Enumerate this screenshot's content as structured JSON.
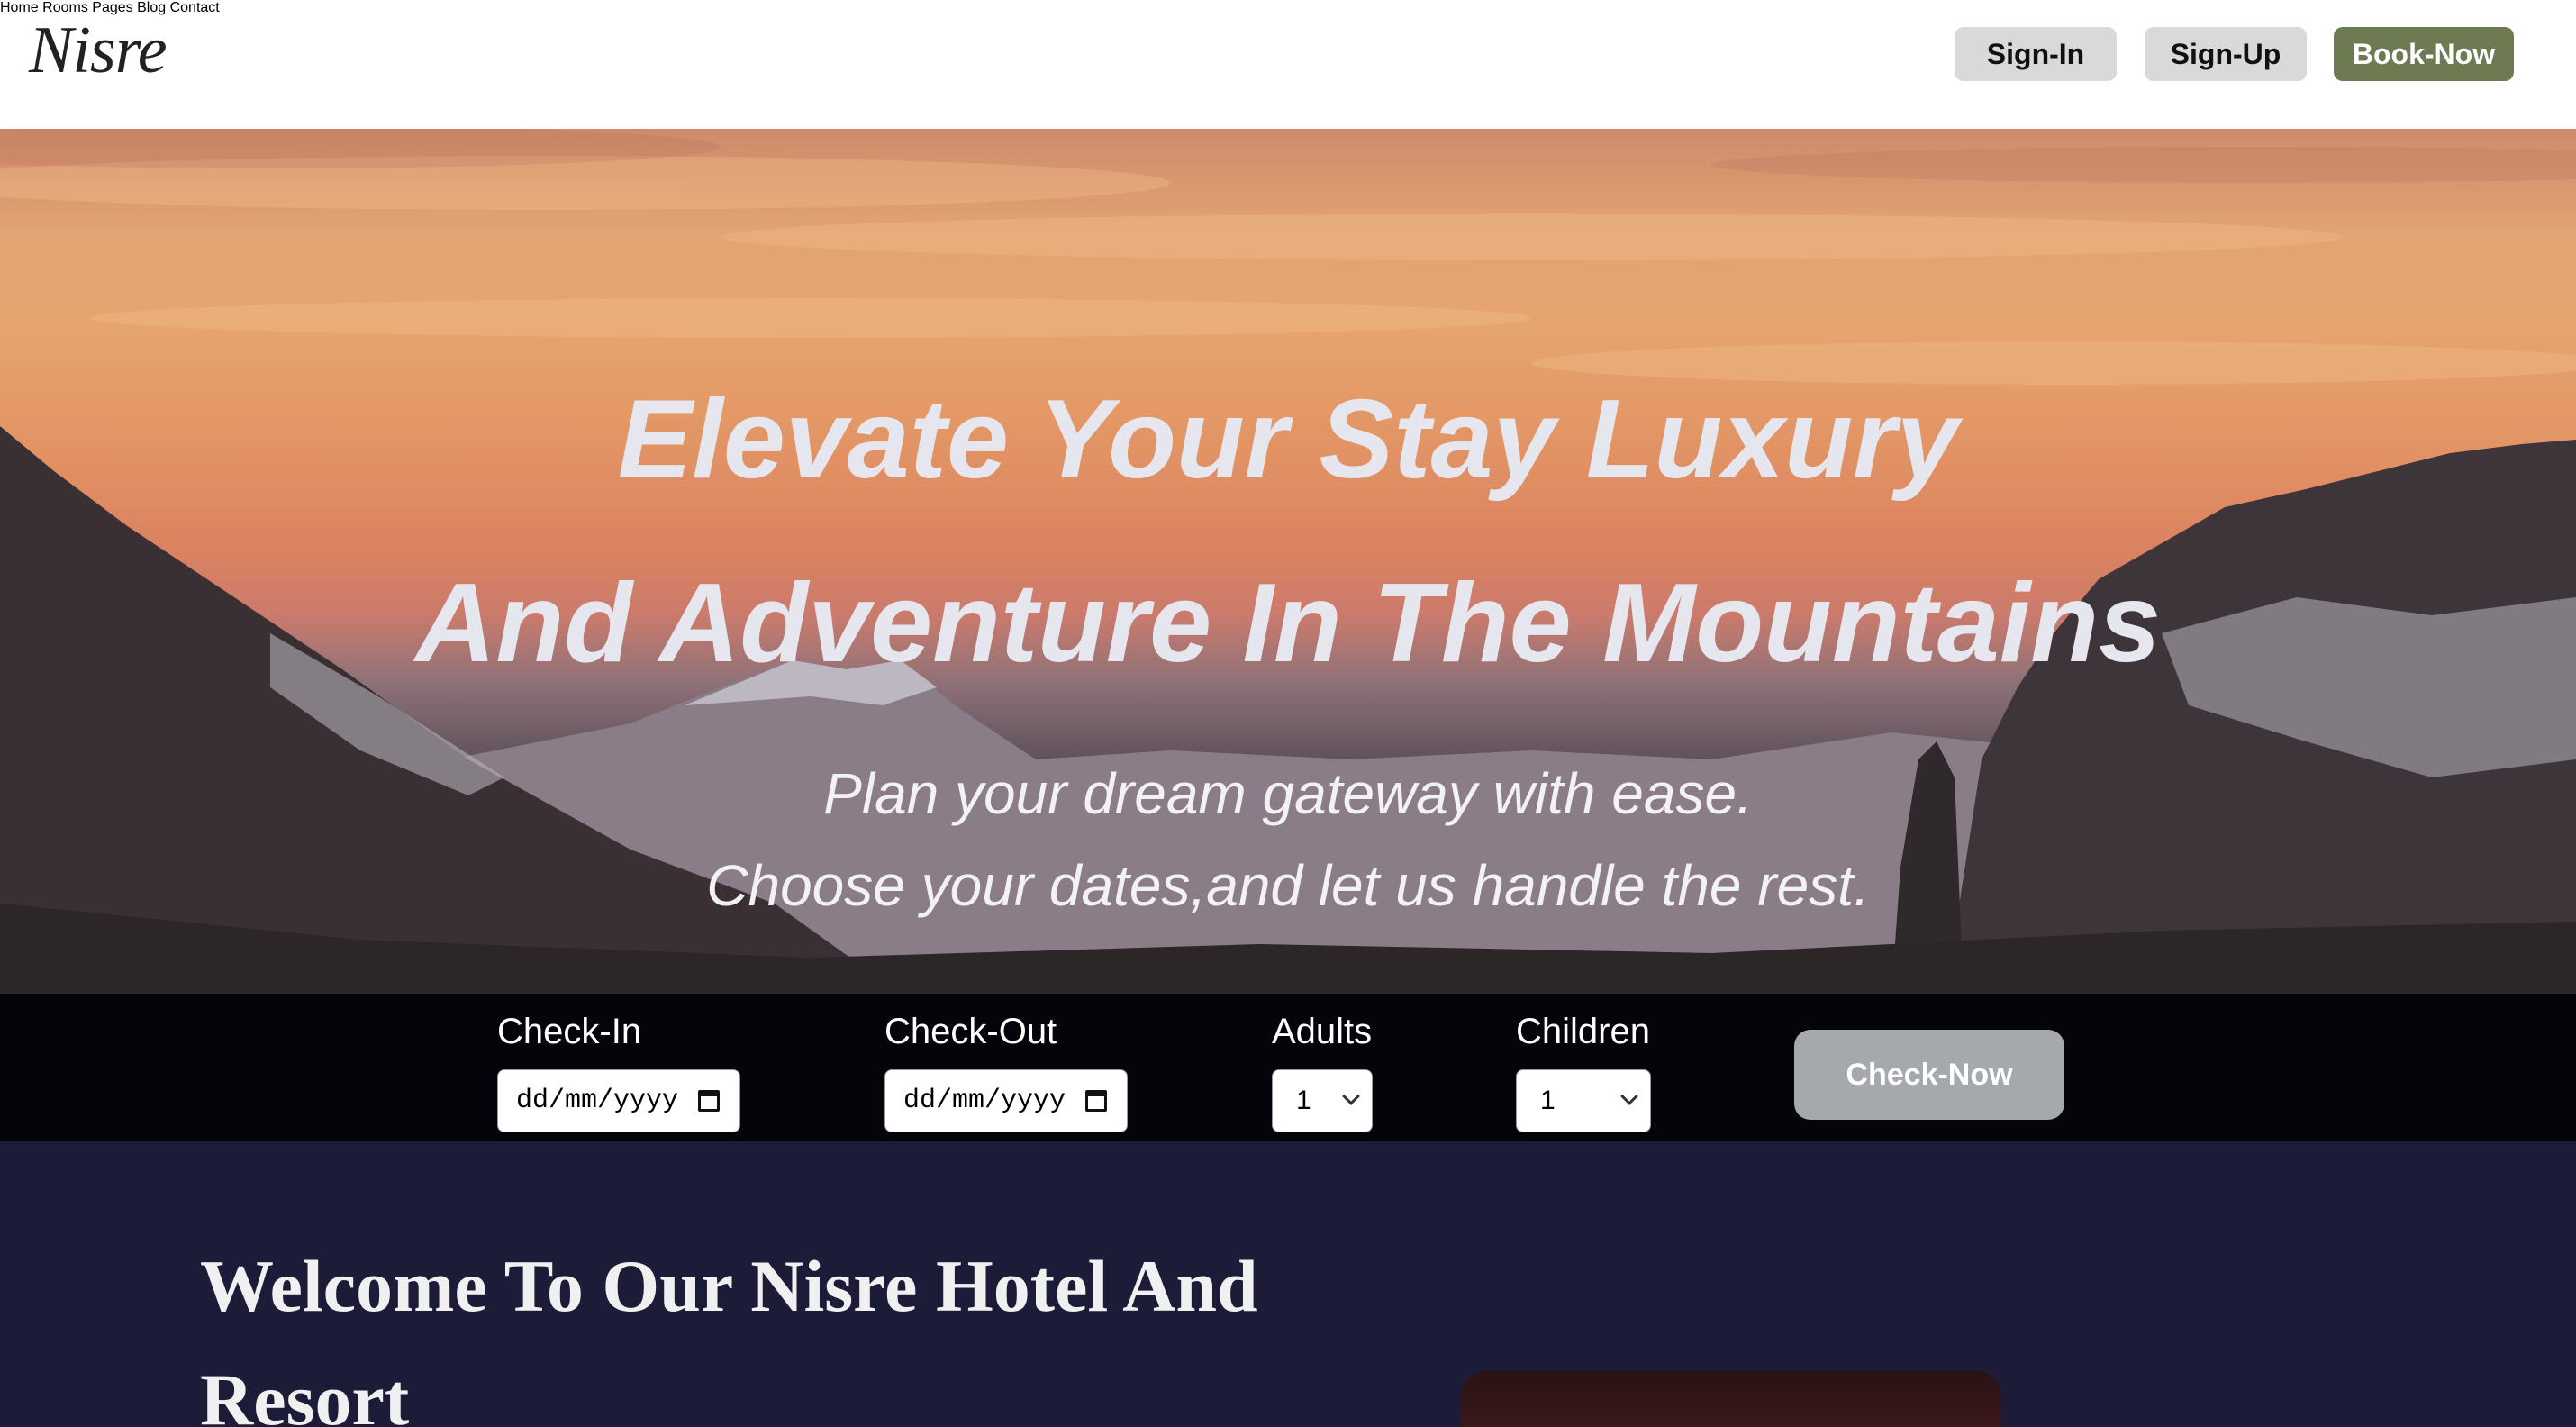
{
  "header": {
    "logo": "Nisre",
    "nav": [
      "Home",
      "Rooms",
      "Pages",
      "Blog",
      "Contact"
    ],
    "sign_in": "Sign-In",
    "sign_up": "Sign-Up",
    "book_now": "Book-Now"
  },
  "hero": {
    "headline_1": "Elevate Your Stay Luxury",
    "headline_2": "And Adventure In The Mountains",
    "sub_1": "Plan your dream gateway with ease.",
    "sub_2": "Choose your dates,and let us handle the rest."
  },
  "booking": {
    "check_in_label": "Check-In",
    "check_in_value": "dd/mm/yyyy",
    "check_out_label": "Check-Out",
    "check_out_value": "dd/mm/yyyy",
    "adults_label": "Adults",
    "adults_value": "1",
    "children_label": "Children",
    "children_value": "1",
    "check_now": "Check-Now"
  },
  "welcome": {
    "title": "Welcome To Our Nisre Hotel And Resort"
  },
  "colors": {
    "brand_green": "#6d7a52",
    "section_bg": "#1c1c38",
    "booking_bg": "#04040a"
  }
}
